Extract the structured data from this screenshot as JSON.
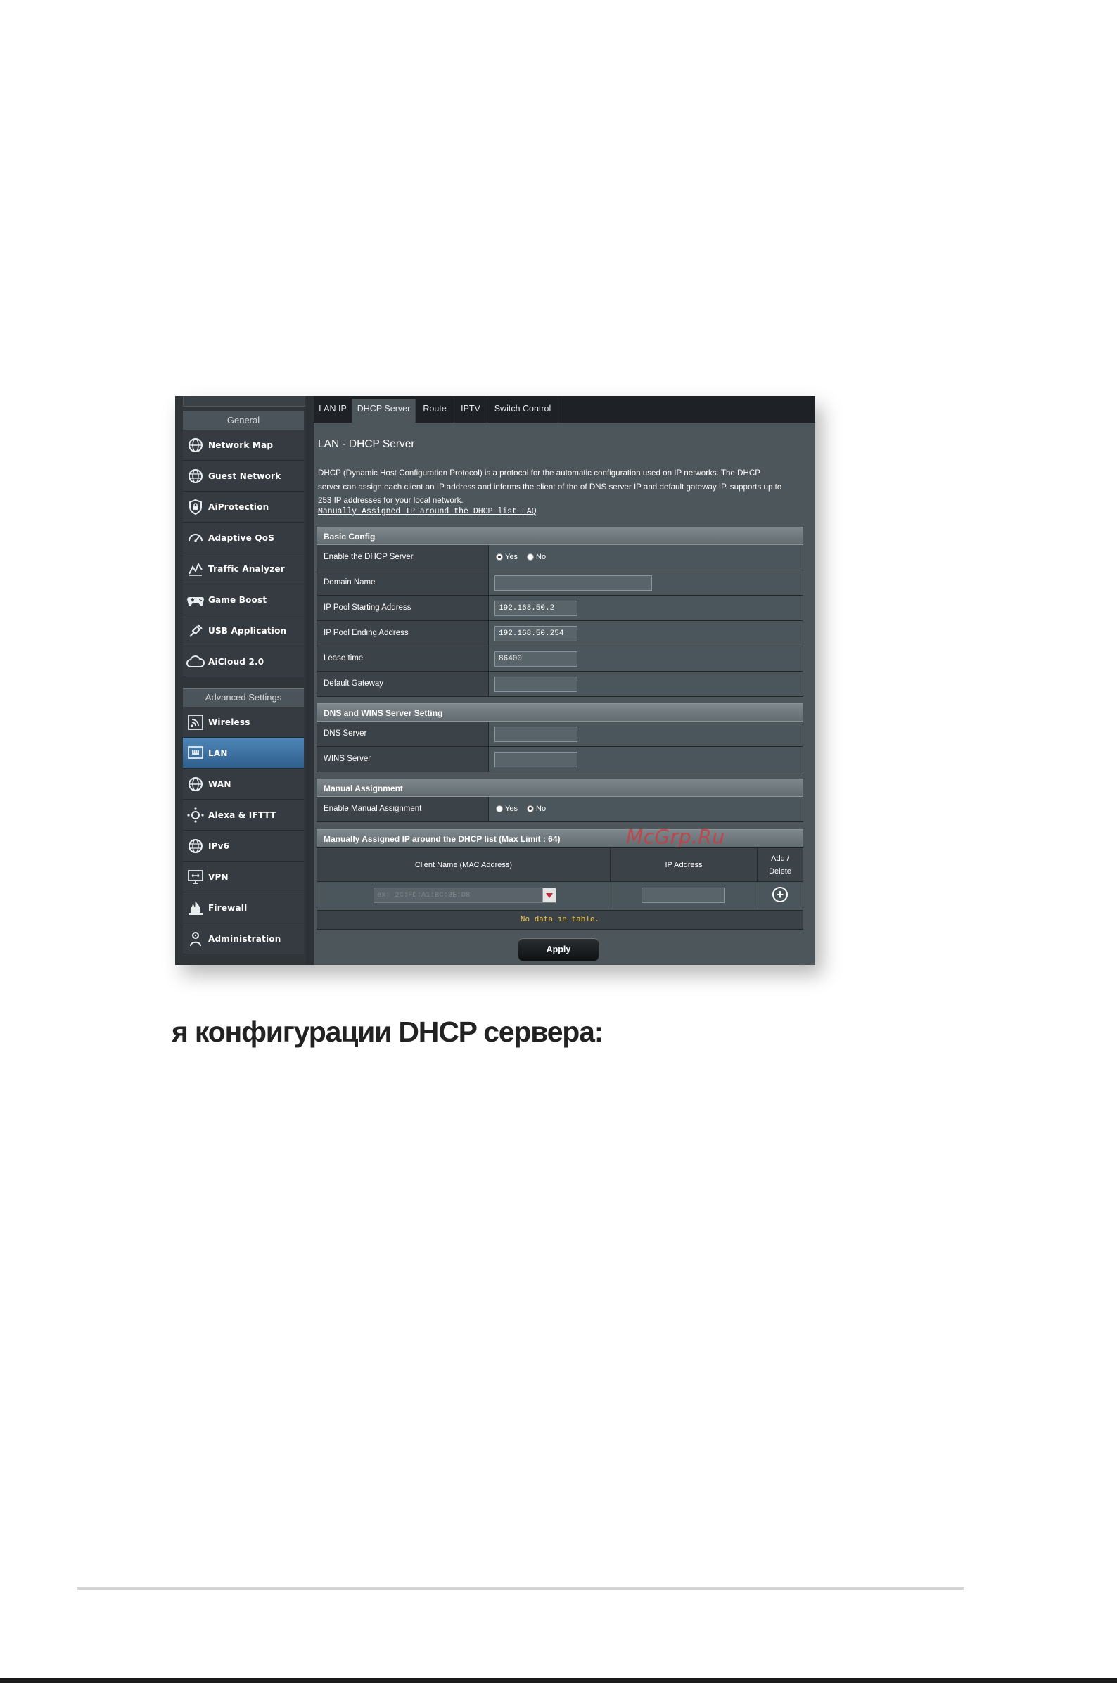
{
  "sidebar": {
    "general_header": "General",
    "general_items": [
      {
        "label": "Network Map",
        "icon": "globe-icon"
      },
      {
        "label": "Guest Network",
        "icon": "globe-network-icon"
      },
      {
        "label": "AiProtection",
        "icon": "lock-icon"
      },
      {
        "label": "Adaptive QoS",
        "icon": "speedometer-icon"
      },
      {
        "label": "Traffic Analyzer",
        "icon": "chart-line-icon"
      },
      {
        "label": "Game Boost",
        "icon": "gamepad-icon"
      },
      {
        "label": "USB Application",
        "icon": "puzzle-icon"
      },
      {
        "label": "AiCloud 2.0",
        "icon": "cloud-icon"
      }
    ],
    "advanced_header": "Advanced Settings",
    "advanced_items": [
      {
        "label": "Wireless",
        "icon": "wifi-icon"
      },
      {
        "label": "LAN",
        "icon": "lan-icon",
        "active": true
      },
      {
        "label": "WAN",
        "icon": "globe-icon"
      },
      {
        "label": "Alexa & IFTTT",
        "icon": "alexa-icon"
      },
      {
        "label": "IPv6",
        "icon": "globe-icon"
      },
      {
        "label": "VPN",
        "icon": "vpn-icon"
      },
      {
        "label": "Firewall",
        "icon": "fire-icon"
      },
      {
        "label": "Administration",
        "icon": "admin-icon"
      }
    ]
  },
  "tabs": [
    {
      "label": "LAN IP"
    },
    {
      "label": "DHCP Server",
      "active": true
    },
    {
      "label": "Route"
    },
    {
      "label": "IPTV"
    },
    {
      "label": "Switch Control"
    }
  ],
  "main": {
    "title": "LAN - DHCP Server",
    "description_lines": [
      "DHCP (Dynamic Host Configuration Protocol) is a protocol for the automatic configuration used on IP networks. The DHCP",
      "server can assign each client an IP address and informs the client of the of DNS server IP and default gateway IP. supports up to",
      "253 IP addresses for your local network."
    ],
    "faq_link": "Manually Assigned IP around the DHCP list FAQ"
  },
  "basic_config": {
    "header": "Basic Config",
    "enable_label": "Enable the DHCP Server",
    "yes": "Yes",
    "no": "No",
    "enable_value": "Yes",
    "domain_label": "Domain Name",
    "domain_value": "",
    "pool_start_label": "IP Pool Starting Address",
    "pool_start_value": "192.168.50.2",
    "pool_end_label": "IP Pool Ending Address",
    "pool_end_value": "192.168.50.254",
    "lease_label": "Lease time",
    "lease_value": "86400",
    "gateway_label": "Default Gateway",
    "gateway_value": ""
  },
  "dns_wins": {
    "header": "DNS and WINS Server Setting",
    "dns_label": "DNS Server",
    "dns_value": "",
    "wins_label": "WINS Server",
    "wins_value": ""
  },
  "manual_assignment": {
    "header": "Manual Assignment",
    "enable_label": "Enable Manual Assignment",
    "yes": "Yes",
    "no": "No",
    "enable_value": "No"
  },
  "manual_list": {
    "header": "Manually Assigned IP around the DHCP list (Max Limit : 64)",
    "col_client": "Client Name (MAC Address)",
    "col_ip": "IP Address",
    "col_add_line1": "Add /",
    "col_add_line2": "Delete",
    "select_placeholder": "ex: 2C:FD:A1:BC:3E:D8",
    "no_data": "No data in table."
  },
  "apply_label": "Apply",
  "watermark": "McGrp.Ru",
  "caption": "я конфигурации DHCP сервера:"
}
